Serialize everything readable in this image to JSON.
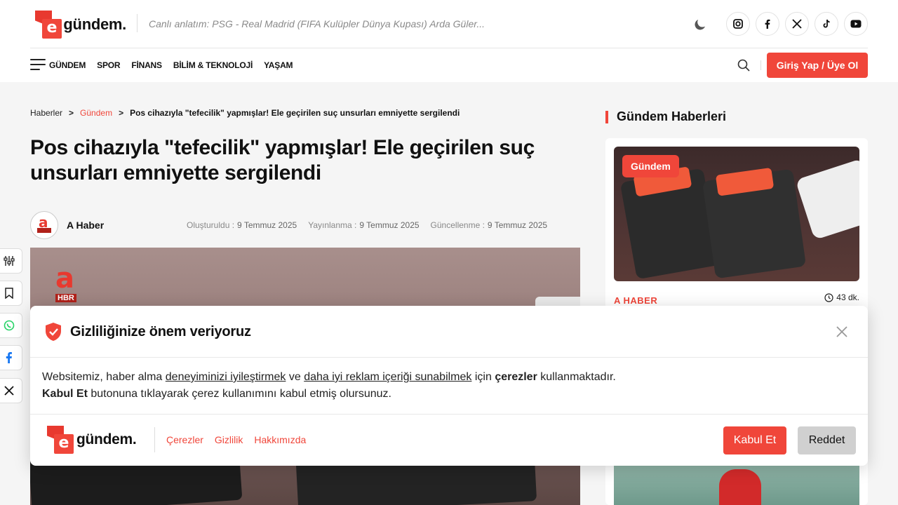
{
  "header": {
    "logo_letter": "e",
    "logo_text": "gündem.",
    "ticker": "Canlı anlatım: PSG - Real Madrid (FIFA Kulüpler Dünya Kupası) Arda Güler...",
    "theme_icon": "moon-icon",
    "socials": [
      "instagram-icon",
      "facebook-icon",
      "x-icon",
      "tiktok-icon",
      "youtube-icon"
    ],
    "nav": [
      "GÜNDEM",
      "SPOR",
      "FİNANS",
      "BİLİM & TEKNOLOJİ",
      "YAŞAM"
    ],
    "login_label": "Giriş Yap / Üye Ol",
    "accent": "#f0463a"
  },
  "article": {
    "breadcrumb": {
      "home": "Haberler",
      "sep": ">",
      "category": "Gündem",
      "current": "Pos cihazıyla \"tefecilik\" yapmışlar! Ele geçirilen suç unsurları emniyette sergilendi"
    },
    "title": "Pos cihazıyla \"tefecilik\" yapmışlar! Ele geçirilen suç unsurları emniyette sergilendi",
    "author": "A Haber",
    "author_avatar_text": "HBR",
    "dates": {
      "created_label": "Oluşturuldu :",
      "created": "9 Temmuz 2025",
      "published_label": "Yayınlanma :",
      "published": "9 Temmuz 2025",
      "updated_label": "Güncellenme :",
      "updated": "9 Temmuz 2025"
    },
    "channel_logo_letter": "a",
    "channel_logo_text": "HBR"
  },
  "share": [
    "settings-icon",
    "bookmark-icon",
    "whatsapp-icon",
    "messenger-icon",
    "x-icon"
  ],
  "sidebar": {
    "heading": "Gündem Haberleri",
    "card": {
      "category": "Gündem",
      "source": "A HABER",
      "read_time": "43 dk."
    }
  },
  "cookie": {
    "title": "Gizliliğinize önem veriyoruz",
    "text_1": "Websitemiz, haber alma ",
    "link_1": "deneyiminizi iyileştirmek",
    "text_2": " ve ",
    "link_2": "daha iyi reklam içeriği sunabilmek",
    "text_3": " için ",
    "bold_1": "çerezler",
    "text_4": " kullanmaktadır.",
    "bold_2": "Kabul Et",
    "text_5": " butonuna tıklayarak çerez kullanımını kabul etmiş olursunuz.",
    "links": [
      "Çerezler",
      "Gizlilik",
      "Hakkımızda"
    ],
    "accept_label": "Kabul Et",
    "reject_label": "Reddet"
  }
}
